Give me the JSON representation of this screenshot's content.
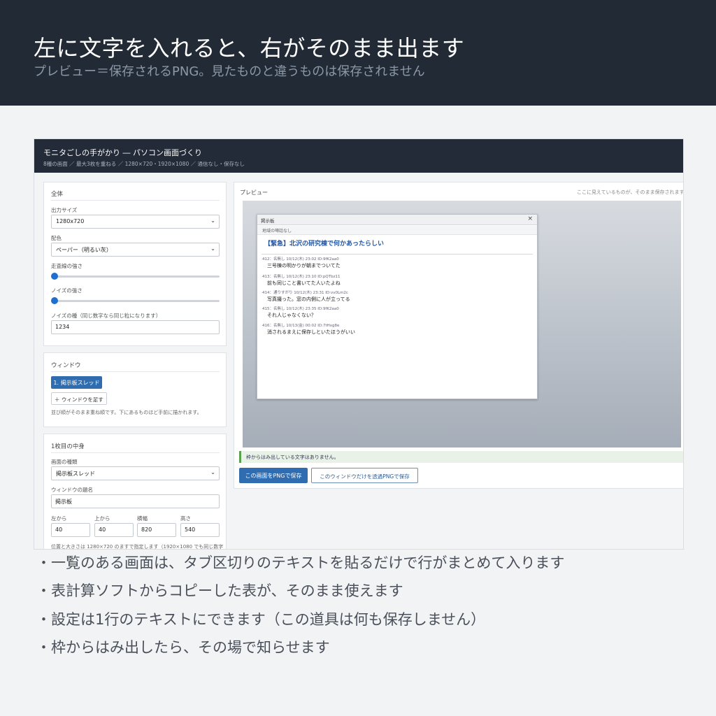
{
  "hero": {
    "title": "左に文字を入れると、右がそのまま出ます",
    "subtitle": "プレビュー＝保存されるPNG。見たものと違うものは保存されません"
  },
  "app": {
    "title": "モニタごしの手がかり ― パソコン画面づくり",
    "subtitle": "8種の画面 ／ 最大3枚を重ねる ／ 1280×720・1920×1080 ／ 通信なし・保存なし"
  },
  "overall": {
    "heading": "全体",
    "output_size_label": "出力サイズ",
    "output_size_value": "1280x720",
    "color_label": "配色",
    "color_value": "ペーパー（明るい灰）",
    "scanline_label": "走査線の強さ",
    "scanline_value": 0,
    "noise_label": "ノイズの強さ",
    "noise_value": 0,
    "seed_label": "ノイズの種（同じ数字なら同じ粒になります）",
    "seed_value": "1234"
  },
  "windows": {
    "heading": "ウィンドウ",
    "item_1": "1. 掲示板スレッド",
    "add_button": "＋ ウィンドウを足す",
    "note": "並び順がそのまま重ね順です。下にあるものほど手前に描かれます。"
  },
  "content": {
    "heading": "1枚目の中身",
    "type_label": "画面の種類",
    "type_value": "掲示板スレッド",
    "name_label": "ウィンドウの題名",
    "name_value": "掲示板",
    "left_label": "左から",
    "left_value": "40",
    "top_label": "上から",
    "top_value": "40",
    "width_label": "横幅",
    "width_value": "820",
    "height_label": "高さ",
    "height_value": "540",
    "note": "位置と大きさは 1280×720 のますで指定します（1920×1080 でも同じ数字"
  },
  "preview": {
    "heading": "プレビュー",
    "hint": "ここに見えているものが、そのまま保存されます",
    "alert": "枠からはみ出している文字はありません。",
    "save_png": "この画面をPNGで保存",
    "save_window_png": "このウィンドウだけを透過PNGで保存"
  },
  "board": {
    "title": "掲示板",
    "board_name": "地域の噂話なし",
    "thread_title": "【緊急】北沢の研究棟で何かあったらしい",
    "posts": [
      {
        "meta": "412：名無し 10/12(木) 23:02  ID:9fK2aa0",
        "body": "三号棟の明かりが朝までついてた"
      },
      {
        "meta": "413：名無し 10/12(木) 23:10  ID:pQTbz11",
        "body": "前も同じこと書いてた人いたよね"
      },
      {
        "meta": "414：通りすがり 10/12(木) 23:31  ID:vv0Lm2c",
        "body": "写真撮った。窓の内側に人が立ってる"
      },
      {
        "meta": "415：名無し 10/12(木) 23:35  ID:9fK2aa0",
        "body": "それ人じゃなくない？"
      },
      {
        "meta": "416：名無し 10/13(金) 00:02  ID:7tHxg8e",
        "body": "消されるまえに保存しといたほうがいい"
      }
    ]
  },
  "bullets": [
    "・一覧のある画面は、タブ区切りのテキストを貼るだけで行がまとめて入ります",
    "・表計算ソフトからコピーした表が、そのまま使えます",
    "・設定は1行のテキストにできます（この道具は何も保存しません）",
    "・枠からはみ出したら、その場で知らせます"
  ]
}
